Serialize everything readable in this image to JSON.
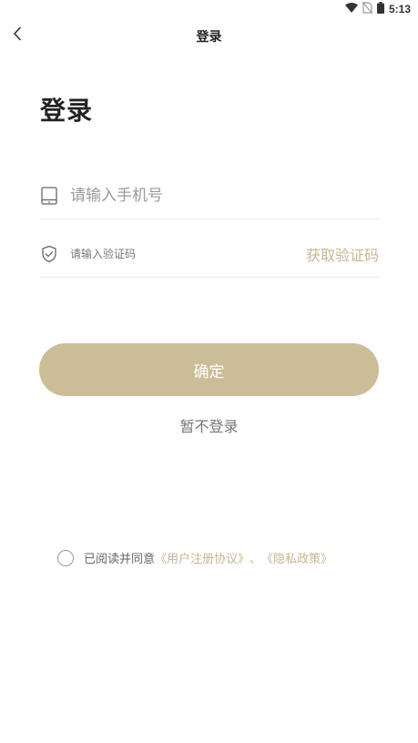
{
  "status_bar": {
    "time": "5:13",
    "icons": [
      "wifi-icon",
      "no-sim-icon",
      "battery-icon"
    ]
  },
  "nav": {
    "back_icon": "chevron-left-icon",
    "title": "登录"
  },
  "heading": "登录",
  "phone_field": {
    "icon": "phone-icon",
    "placeholder": "请输入手机号",
    "value": ""
  },
  "code_field": {
    "icon": "shield-check-icon",
    "placeholder": "请输入验证码",
    "value": "",
    "get_code_label": "获取验证码"
  },
  "confirm_button": {
    "label": "确定"
  },
  "skip_label": "暂不登录",
  "agreement": {
    "prefix": "已阅读并同意",
    "terms_link": "《用户注册协议》",
    "separator": "、",
    "privacy_link": "《隐私政策》",
    "checked": false
  },
  "colors": {
    "accent": "#c8b691",
    "button": "#cbbd98",
    "divider": "#ececec"
  }
}
